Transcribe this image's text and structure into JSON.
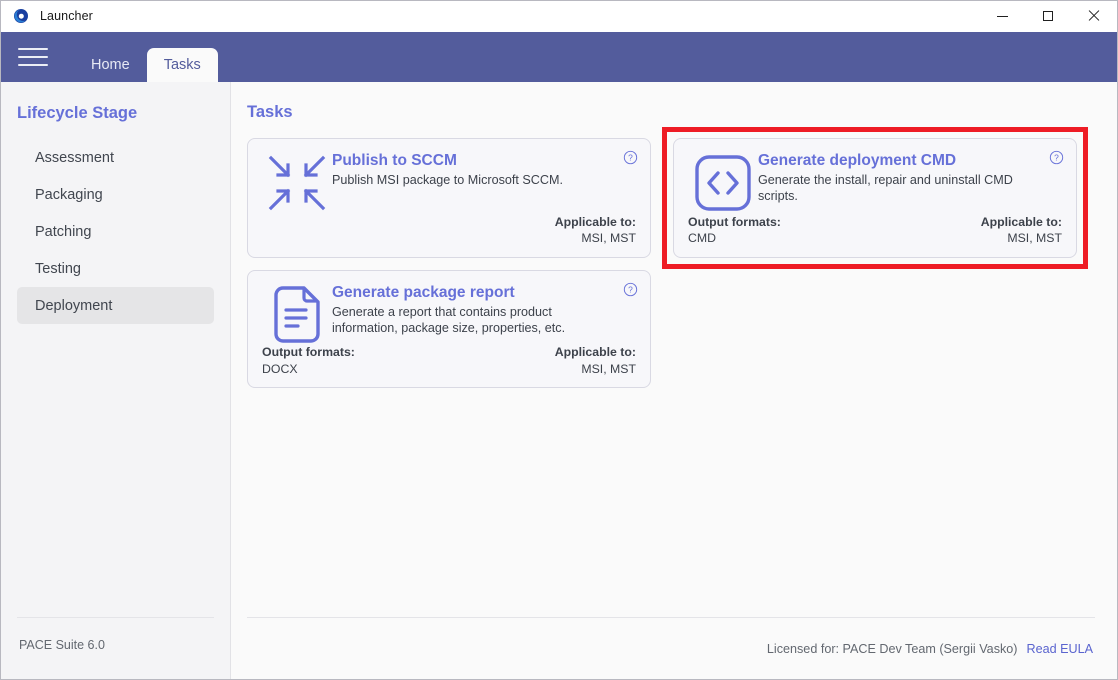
{
  "window": {
    "app_icon": "pace-logo-icon",
    "title": "Launcher",
    "controls": {
      "minimize": "minimize-icon",
      "maximize": "maximize-icon",
      "close": "close-icon"
    }
  },
  "navbar": {
    "menu_icon": "hamburger-icon",
    "tabs": [
      {
        "label": "Home",
        "active": false
      },
      {
        "label": "Tasks",
        "active": true
      }
    ]
  },
  "sidebar": {
    "title": "Lifecycle Stage",
    "items": [
      {
        "label": "Assessment",
        "active": false
      },
      {
        "label": "Packaging",
        "active": false
      },
      {
        "label": "Patching",
        "active": false
      },
      {
        "label": "Testing",
        "active": false
      },
      {
        "label": "Deployment",
        "active": true
      }
    ],
    "footer": "PACE Suite 6.0"
  },
  "main": {
    "heading": "Tasks",
    "cards": [
      {
        "icon": "collapse-arrows-icon",
        "title": "Publish to SCCM",
        "description": "Publish MSI package to Microsoft SCCM.",
        "output_formats_label": "",
        "output_formats_value": "",
        "applicable_label": "Applicable to:",
        "applicable_value": "MSI, MST",
        "help": "help-icon",
        "highlighted": false
      },
      {
        "icon": "code-brackets-icon",
        "title": "Generate deployment CMD",
        "description": "Generate the install, repair and uninstall CMD scripts.",
        "output_formats_label": "Output formats:",
        "output_formats_value": "CMD",
        "applicable_label": "Applicable to:",
        "applicable_value": "MSI, MST",
        "help": "help-icon",
        "highlighted": true
      },
      {
        "icon": "document-lines-icon",
        "title": "Generate package report",
        "description": "Generate a report that contains product information, package size, properties, etc.",
        "output_formats_label": "Output formats:",
        "output_formats_value": "DOCX",
        "applicable_label": "Applicable to:",
        "applicable_value": "MSI, MST",
        "help": "help-icon",
        "highlighted": false
      }
    ],
    "footer": {
      "license_text": "Licensed for: PACE Dev Team (Sergii Vasko)",
      "eula_link": "Read EULA"
    }
  },
  "colors": {
    "navbar": "#535c9b",
    "accent": "#6670d8",
    "highlight_border": "#ee1c25",
    "sidebar_bg": "#f4f4f6",
    "card_bg": "#f7f7fa"
  }
}
